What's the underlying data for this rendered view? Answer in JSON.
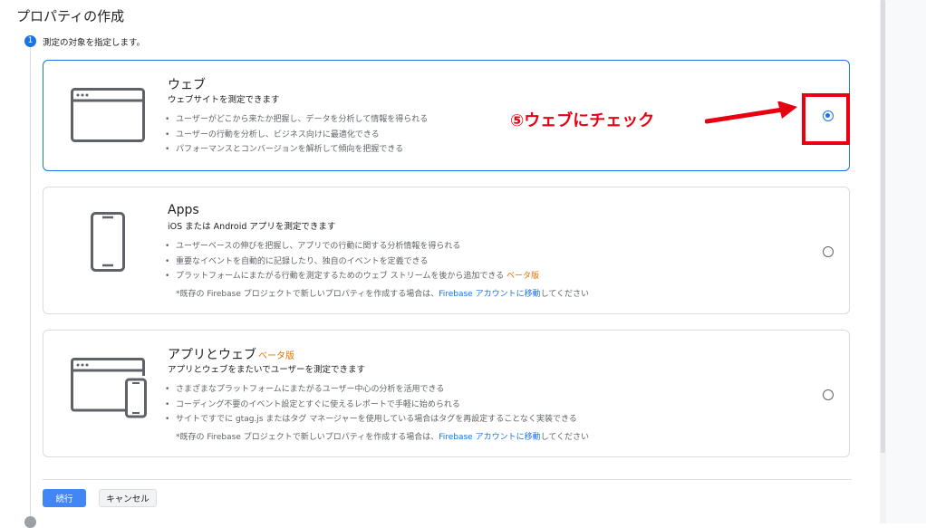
{
  "page_title": "プロパティの作成",
  "step1": {
    "number": "1",
    "label": "測定の対象を指定します。"
  },
  "cards": [
    {
      "title": "ウェブ",
      "subtitle": "ウェブサイトを測定できます",
      "bullets": [
        "ユーザーがどこから来たか把握し、データを分析して情報を得られる",
        "ユーザーの行動を分析し、ビジネス向けに最適化できる",
        "パフォーマンスとコンバージョンを解析して傾向を把握できる"
      ],
      "selected": true,
      "icon": "browser-window-icon"
    },
    {
      "title": "Apps",
      "subtitle": "iOS または Android アプリを測定できます",
      "bullets": [
        "ユーザーベースの伸びを把握し、アプリでの行動に関する分析情報を得られる",
        "重要なイベントを自動的に記録したり、独自のイベントを定義できる",
        "プラットフォームにまたがる行動を測定するためのウェブ ストリームを後から追加できる"
      ],
      "beta_label": "ベータ版",
      "note_prefix": "*既存の Firebase プロジェクトで新しいプロパティを作成する場合は、",
      "note_link": "Firebase アカウントに移動",
      "note_suffix": "してください",
      "selected": false,
      "icon": "smartphone-icon"
    },
    {
      "title": "アプリとウェブ",
      "beta_label": "ベータ版",
      "subtitle": "アプリとウェブをまたいでユーザーを測定できます",
      "bullets": [
        "さまざまなプラットフォームにまたがるユーザー中心の分析を活用できる",
        "コーディング不要のイベント設定とすぐに使えるレポートで手軽に始められる",
        "サイトですでに gtag.js またはタグ マネージャーを使用している場合はタグを再設定することなく実装できる"
      ],
      "note_prefix": "*既存の Firebase プロジェクトで新しいプロパティを作成する場合は、",
      "note_link": "Firebase アカウントに移動",
      "note_suffix": "してください",
      "selected": false,
      "icon": "browser-and-phone-icon"
    }
  ],
  "annotation": {
    "text": "⑤ウェブにチェック",
    "color": "#e60012"
  },
  "buttons": {
    "continue": "続行",
    "cancel": "キャンセル"
  },
  "colors": {
    "accent": "#1a73e8",
    "beta": "#e37400",
    "annotation_red": "#e60012",
    "primary_button": "#4285f4"
  }
}
